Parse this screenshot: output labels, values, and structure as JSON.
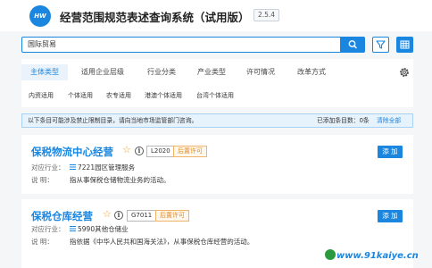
{
  "header": {
    "logo_text": "HW",
    "title": "经营范围规范表述查询系统（试用版）",
    "version": "2.5.4"
  },
  "search": {
    "value": "国际贸易"
  },
  "tabs": [
    {
      "label": "主体类型",
      "active": true
    },
    {
      "label": "适用企业层级"
    },
    {
      "label": "行业分类"
    },
    {
      "label": "产业类型"
    },
    {
      "label": "许可情况"
    },
    {
      "label": "改革方式"
    }
  ],
  "subfilters": [
    "内资适用",
    "个体适用",
    "农专适用",
    "港澳个体适用",
    "台湾个体适用"
  ],
  "notice": {
    "text": "以下条目可能涉及禁止限制目录，请向当地市场监管部门咨询。",
    "count_text": "已添加条目数：0条",
    "clear_label": "清除全部"
  },
  "items": [
    {
      "title": "保税物流中心经营",
      "code": "L2020",
      "permit": "后置许可",
      "add_label": "添 加",
      "industry_label": "对应行业：",
      "industry": "7221园区管理服务",
      "desc_label": "说 明：",
      "desc": "指从事保税仓储物流业务的活动。"
    },
    {
      "title": "保税仓库经营",
      "code": "G7011",
      "permit": "后置许可",
      "add_label": "添 加",
      "industry_label": "对应行业：",
      "industry": "5990其他仓储业",
      "desc_label": "说 明：",
      "desc": "指依据《中华人民共和国海关法》，从事保税仓库经营的活动。"
    }
  ],
  "watermark": "www.91kaiye.cn",
  "colors": {
    "accent": "#1a86e0",
    "permit": "#e68a1a",
    "star": "#f0a020"
  }
}
